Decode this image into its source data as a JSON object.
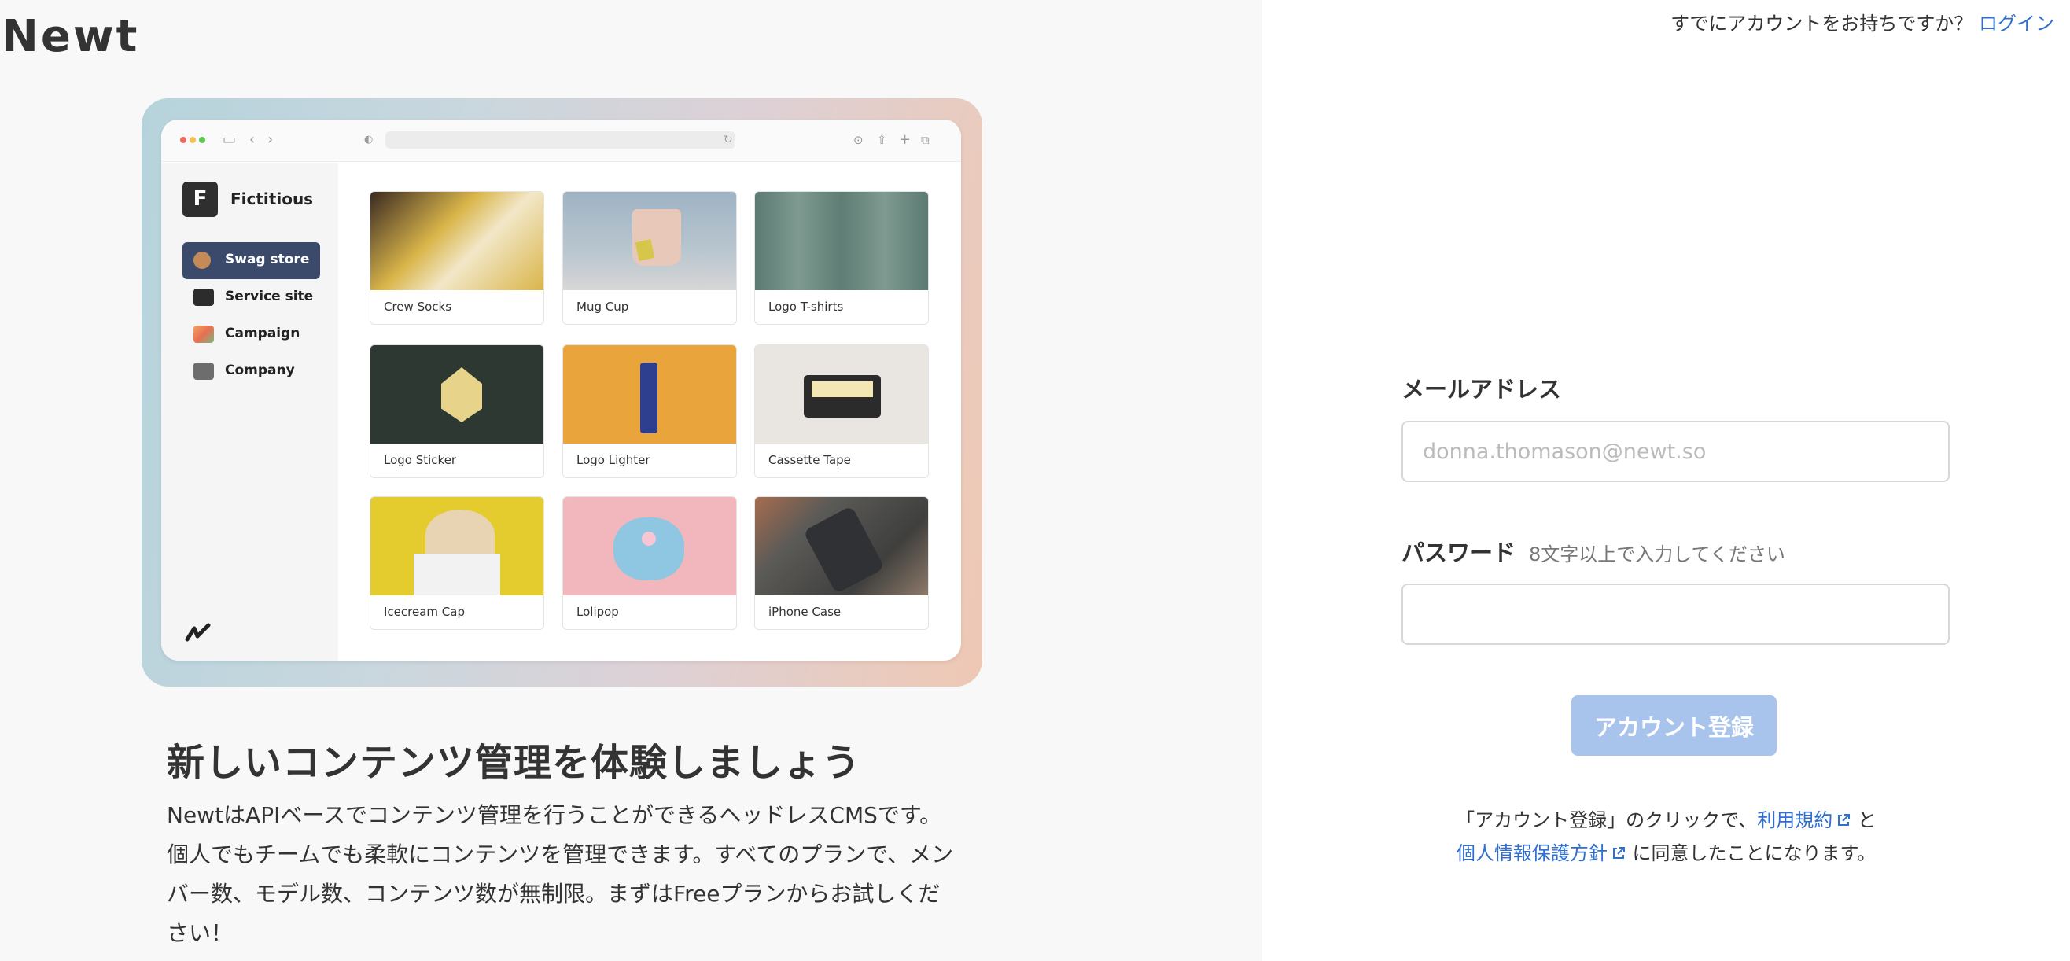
{
  "brand": {
    "logo": "Newt"
  },
  "preview": {
    "workspace_initial": "F",
    "workspace_name": "Fictitious",
    "nav": [
      {
        "label": "Swag store",
        "active": true
      },
      {
        "label": "Service site",
        "active": false
      },
      {
        "label": "Campaign",
        "active": false
      },
      {
        "label": "Company",
        "active": false
      }
    ],
    "products": [
      {
        "label": "Crew Socks",
        "color": "#d9b54a"
      },
      {
        "label": "Mug Cup",
        "color": "#a9b9c6"
      },
      {
        "label": "Logo T-shirts",
        "color": "#6f8a82"
      },
      {
        "label": "Logo Sticker",
        "color": "#2f3a35"
      },
      {
        "label": "Logo Lighter",
        "color": "#e8a23a"
      },
      {
        "label": "Cassette Tape",
        "color": "#e9e6e2"
      },
      {
        "label": "Icecream Cap",
        "color": "#e4cc2f"
      },
      {
        "label": "Lolipop",
        "color": "#f1b7bd"
      },
      {
        "label": "iPhone Case",
        "color": "#5b5a57"
      }
    ]
  },
  "intro": {
    "headline": "新しいコンテンツ管理を体験しましょう",
    "description": "NewtはAPIベースでコンテンツ管理を行うことができるヘッドレスCMSです。個人でもチームでも柔軟にコンテンツを管理できます。すべてのプランで、メンバー数、モデル数、コンテンツ数が無制限。まずはFreeプランからお試しください！"
  },
  "header": {
    "already_text": "すでにアカウントをお持ちですか？",
    "login_link": "ログイン"
  },
  "form": {
    "email_label": "メールアドレス",
    "email_placeholder": "donna.thomason@newt.so",
    "password_label": "パスワード",
    "password_hint": "8文字以上で入力してください",
    "submit_label": "アカウント登録",
    "terms_prefix": "「アカウント登録」のクリックで、",
    "terms_link": "利用規約",
    "terms_and": "と",
    "privacy_link": "個人情報保護方針",
    "terms_suffix": "に同意したことになります。"
  },
  "colors": {
    "accent": "#2f6fd0",
    "button_disabled": "#a9c4ec",
    "nav_active": "#3b4a6b"
  }
}
